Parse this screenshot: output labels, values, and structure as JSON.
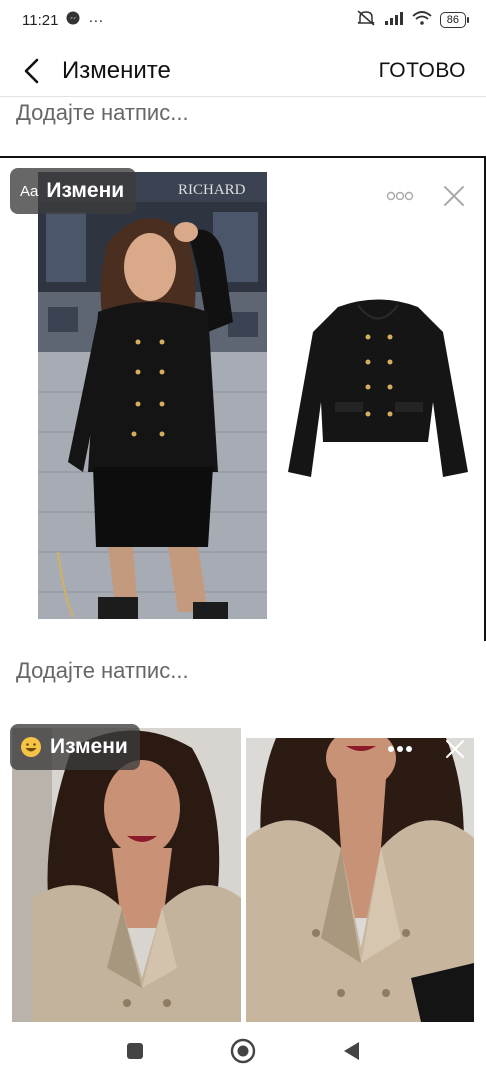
{
  "status_bar": {
    "time": "11:21",
    "ellipsis": "···",
    "battery": "86"
  },
  "header": {
    "title": "Измените",
    "done": "ГОТОВО"
  },
  "captions": {
    "top": "Додајте натпис...",
    "middle": "Додајте натпис..."
  },
  "card1": {
    "edit_prefix": "Aa",
    "edit_label": "Измени",
    "storefront_text": "RICHARD"
  },
  "card2": {
    "edit_label": "Измени"
  },
  "colors": {
    "overlay": "#3c3c3c",
    "text": "#111111",
    "caption": "#666666"
  }
}
